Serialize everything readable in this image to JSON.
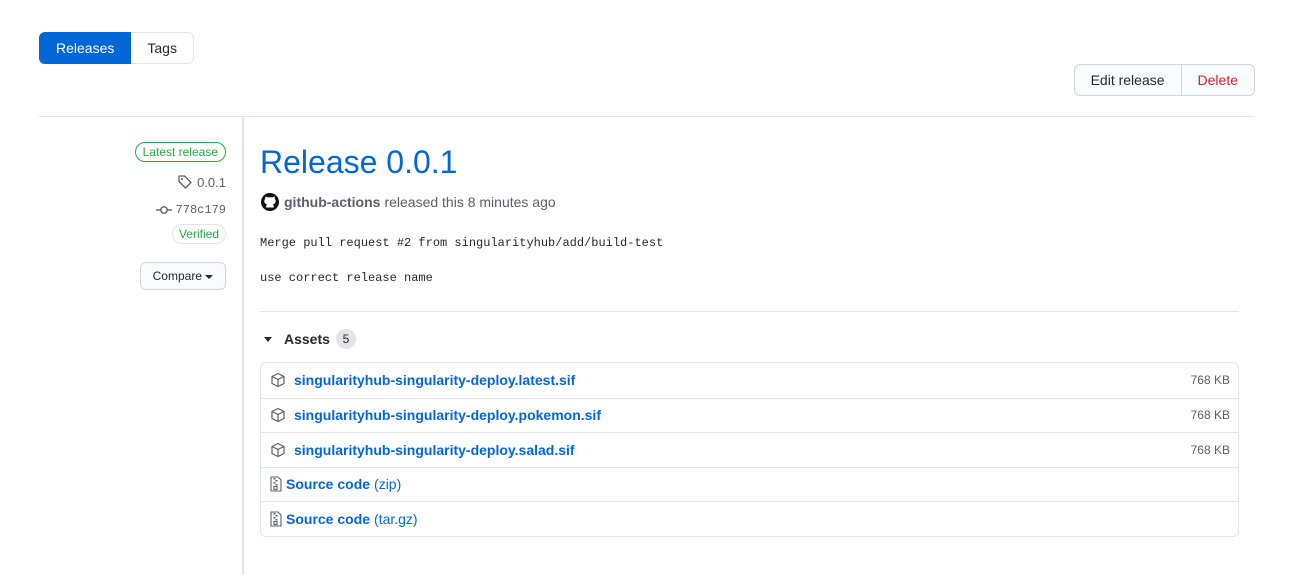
{
  "tabs": {
    "releases": "Releases",
    "tags": "Tags"
  },
  "actions": {
    "edit": "Edit release",
    "delete": "Delete"
  },
  "sidebar": {
    "latest_badge": "Latest release",
    "tag": "0.0.1",
    "commit": "778c179",
    "verified": "Verified",
    "compare": "Compare"
  },
  "release": {
    "title": "Release 0.0.1",
    "author": "github-actions",
    "released_text": "released this 8 minutes ago",
    "body_line_1": "Merge pull request #2 from singularityhub/add/build-test",
    "body_line_2": "use correct release name"
  },
  "assets": {
    "label": "Assets",
    "count": "5",
    "files": [
      {
        "name": "singularityhub-singularity-deploy.latest.sif",
        "size": "768 KB"
      },
      {
        "name": "singularityhub-singularity-deploy.pokemon.sif",
        "size": "768 KB"
      },
      {
        "name": "singularityhub-singularity-deploy.salad.sif",
        "size": "768 KB"
      }
    ],
    "sources": [
      {
        "name": "Source code",
        "format": "(zip)"
      },
      {
        "name": "Source code",
        "format": "(tar.gz)"
      }
    ]
  },
  "icons": {
    "tag": "tag-icon",
    "commit": "git-commit-icon",
    "avatar": "github-mark-icon",
    "package": "package-icon",
    "zip": "file-zip-icon",
    "caret": "triangle-down-icon"
  },
  "colors": {
    "accent": "#0366d6",
    "success": "#28a745",
    "danger": "#cb2431",
    "border": "#e1e4e8",
    "muted": "#586069"
  }
}
